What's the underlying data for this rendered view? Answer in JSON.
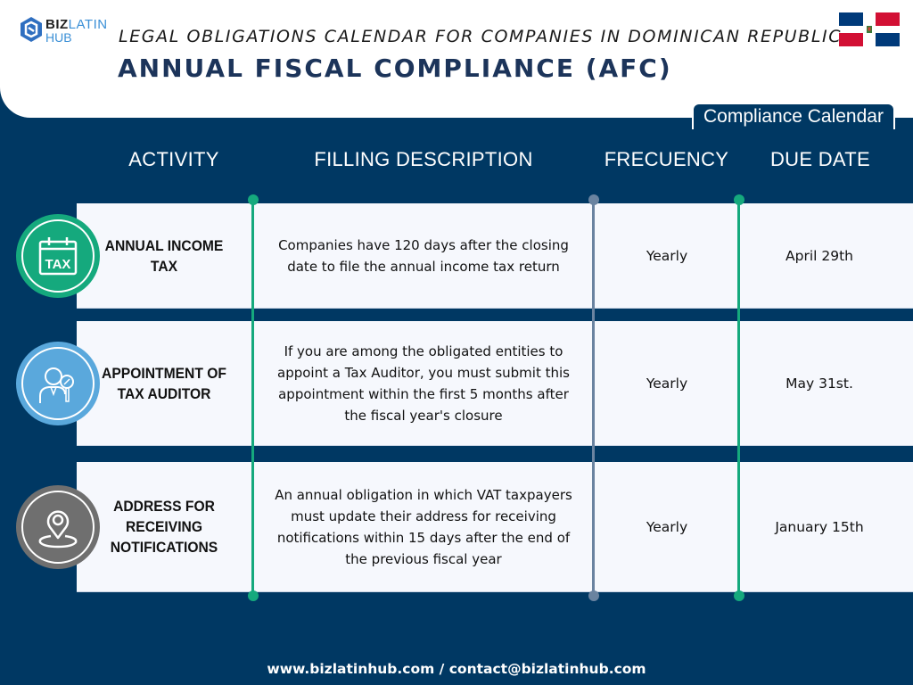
{
  "brand": {
    "logo_text_biz": "BIZ",
    "logo_text_latin": "LATIN",
    "logo_text_hub": "HUB"
  },
  "header": {
    "subtitle": "LEGAL OBLIGATIONS CALENDAR FOR COMPANIES IN DOMINICAN REPUBLIC",
    "title": "ANNUAL FISCAL COMPLIANCE (AFC)",
    "flag": "dominican-republic-flag"
  },
  "tag": "Compliance Calendar",
  "columns": {
    "activity": "ACTIVITY",
    "description": "FILLING DESCRIPTION",
    "frequency": "FRECUENCY",
    "due_date": "DUE DATE"
  },
  "rows": [
    {
      "icon": "tax-calendar-icon",
      "icon_color": "#15a97d",
      "activity": "ANNUAL INCOME TAX",
      "description": "Companies have 120 days after the closing date to file the annual income tax return",
      "frequency": "Yearly",
      "due_date": "April 29th"
    },
    {
      "icon": "tax-auditor-icon",
      "icon_color": "#5aa8dc",
      "activity": "APPOINTMENT OF TAX AUDITOR",
      "description": "If you are among the obligated entities to appoint a Tax Auditor, you must submit this appointment within the first 5 months after the fiscal year's closure",
      "frequency": "Yearly",
      "due_date": "May 31st."
    },
    {
      "icon": "location-pin-icon",
      "icon_color": "#6f6f6f",
      "activity": "ADDRESS FOR RECEIVING NOTIFICATIONS",
      "description": "An annual obligation in which VAT taxpayers must update their address for receiving notifications within 15 days after the end of the previous fiscal year",
      "frequency": "Yearly",
      "due_date": "January 15th"
    }
  ],
  "colors": {
    "navy": "#003863",
    "title_navy": "#1c345a",
    "green": "#15a97d",
    "slate": "#6a83a0"
  },
  "footer": "www.bizlatinhub.com / contact@bizlatinhub.com"
}
